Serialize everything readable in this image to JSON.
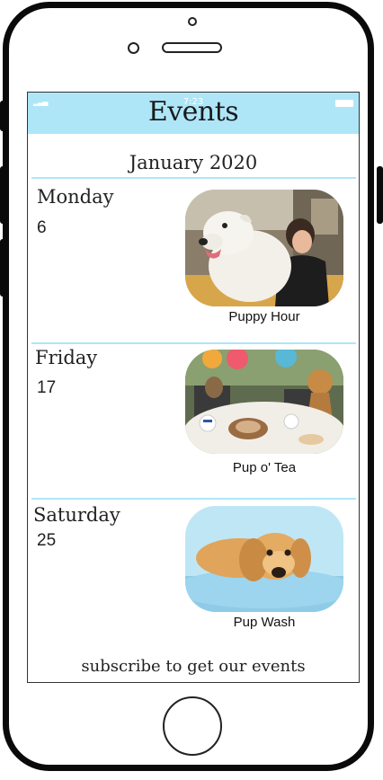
{
  "status": {
    "time": "7:23"
  },
  "header": {
    "title": "Events"
  },
  "month": "January 2020",
  "events": [
    {
      "weekday": "Monday",
      "day": "6",
      "name": "Puppy Hour"
    },
    {
      "weekday": "Friday",
      "day": "17",
      "name": "Pup o' Tea"
    },
    {
      "weekday": "Saturday",
      "day": "25",
      "name": "Pup Wash"
    }
  ],
  "footer": {
    "subscribe_text": "subscribe to get our events"
  },
  "colors": {
    "accent": "#aee6f8",
    "frame": "#0a0a0a"
  }
}
